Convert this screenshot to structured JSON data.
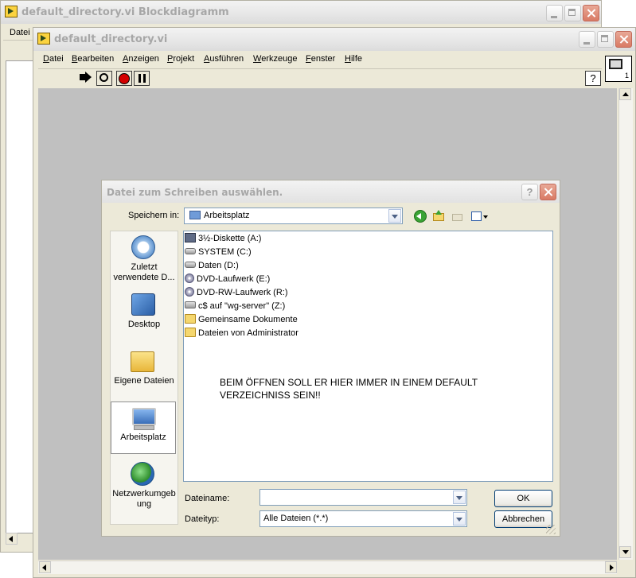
{
  "back_window": {
    "title": "default_directory.vi Blockdiagramm",
    "menu_first": "Datei"
  },
  "front_window": {
    "title": "default_directory.vi",
    "menu": [
      {
        "label": "Datei",
        "mn": "D",
        "rest": "atei"
      },
      {
        "label": "Bearbeiten",
        "mn": "B",
        "rest": "earbeiten"
      },
      {
        "label": "Anzeigen",
        "mn": "A",
        "rest": "nzeigen"
      },
      {
        "label": "Projekt",
        "mn": "P",
        "rest": "rojekt"
      },
      {
        "label": "Ausführen",
        "mn": "A",
        "rest": "usführen"
      },
      {
        "label": "Werkzeuge",
        "mn": "W",
        "rest": "erkzeuge"
      },
      {
        "label": "Fenster",
        "mn": "F",
        "rest": "enster"
      },
      {
        "label": "Hilfe",
        "mn": "H",
        "rest": "ilfe"
      }
    ],
    "connector_number": "1",
    "help_glyph": "?"
  },
  "dialog": {
    "title": "Datei zum Schreiben auswählen.",
    "save_in_label": "Speichern in:",
    "save_in_value": "Arbeitsplatz",
    "places": [
      {
        "line1": "Zuletzt",
        "line2": "verwendete D..."
      },
      {
        "line1": "Desktop",
        "line2": ""
      },
      {
        "line1": "Eigene Dateien",
        "line2": ""
      },
      {
        "line1": "Arbeitsplatz",
        "line2": ""
      },
      {
        "line1": "Netzwerkumgeb",
        "line2": "ung"
      }
    ],
    "files": [
      {
        "name": "3½-Diskette (A:)",
        "icon": "floppy-icon"
      },
      {
        "name": "SYSTEM (C:)",
        "icon": "hard-drive-icon"
      },
      {
        "name": "Daten (D:)",
        "icon": "hard-drive-icon"
      },
      {
        "name": "DVD-Laufwerk (E:)",
        "icon": "dvd-drive-icon"
      },
      {
        "name": "DVD-RW-Laufwerk (R:)",
        "icon": "dvd-drive-icon"
      },
      {
        "name": "c$ auf \"wg-server\" (Z:)",
        "icon": "network-drive-icon"
      },
      {
        "name": "Gemeinsame Dokumente",
        "icon": "folder-icon"
      },
      {
        "name": "Dateien von Administrator",
        "icon": "folder-icon"
      }
    ],
    "annotation_line1": "BEIM ÖFFNEN SOLL ER HIER IMMER IN EINEM DEFAULT",
    "annotation_line2": "VERZEICHNISS SEIN!!",
    "filename_label": "Dateiname:",
    "filename_value": "",
    "filetype_label": "Dateityp:",
    "filetype_value": "Alle Dateien (*.*)",
    "ok_label": "OK",
    "cancel_label": "Abbrechen",
    "help_glyph": "?"
  }
}
